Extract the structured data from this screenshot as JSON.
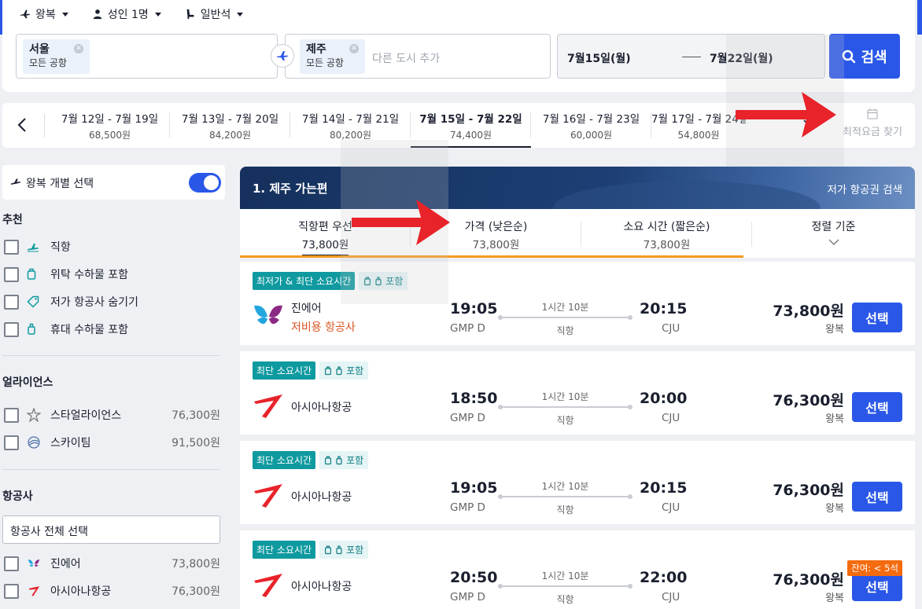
{
  "options": {
    "trip": "왕복",
    "passengers": "성인 1명",
    "cabin": "일반석"
  },
  "search": {
    "origin": {
      "city": "서울",
      "airport": "모든 공항"
    },
    "destination": {
      "city": "제주",
      "airport": "모든 공항"
    },
    "add_city_placeholder": "다른 도시 추가",
    "depart_date": "7월15일(월)",
    "return_date": "7월22일(월)",
    "button": "검색"
  },
  "date_strip": {
    "items": [
      {
        "range": "7월 12일 - 7월 19일",
        "price": "68,500원"
      },
      {
        "range": "7월 13일 - 7월 20일",
        "price": "84,200원"
      },
      {
        "range": "7월 14일 - 7월 21일",
        "price": "80,200원"
      },
      {
        "range": "7월 15일 - 7월 22일",
        "price": "74,400원"
      },
      {
        "range": "7월 16일 - 7월 23일",
        "price": "60,000원"
      },
      {
        "range": "7월 17일 - 7월 24일",
        "price": "54,800원"
      }
    ],
    "cheapest_label": "최적요금 찾기"
  },
  "sidebar": {
    "roundtrip_toggle": "왕복 개별 선택",
    "recommend_title": "추천",
    "recommend": [
      "직항",
      "위탁 수하물 포함",
      "저가 항공사 숨기기",
      "휴대 수하물 포함"
    ],
    "alliance_title": "얼라이언스",
    "alliances": [
      {
        "name": "스타얼라이언스",
        "price": "76,300원"
      },
      {
        "name": "스카이팀",
        "price": "91,500원"
      }
    ],
    "airline_title": "항공사",
    "airline_select_all": "항공사 전체 선택",
    "airlines": [
      {
        "name": "진에어",
        "price": "73,800원"
      },
      {
        "name": "아시아나항공",
        "price": "76,300원"
      }
    ]
  },
  "results": {
    "heading": "1. 제주 가는편",
    "cheap_link": "저가 항공권 검색",
    "sort": [
      {
        "title": "직항편 우선",
        "price": "73,800원"
      },
      {
        "title": "가격 (낮은순)",
        "price": "73,800원"
      },
      {
        "title": "소요 시간 (짧은순)",
        "price": "73,800원"
      },
      {
        "title": "정렬 기준",
        "price": ""
      }
    ],
    "flights": [
      {
        "badge": "최저가 & 최단 소요시간",
        "bag": "포함",
        "airline": "진에어",
        "lcc": "저비용 항공사",
        "dep": "19:05",
        "dep_code": "GMP D",
        "dur": "1시간 10분",
        "stops": "직항",
        "arr": "20:15",
        "arr_code": "CJU",
        "price": "73,800원",
        "price_note": "왕복",
        "select": "선택",
        "seats": ""
      },
      {
        "badge": "최단 소요시간",
        "bag": "포함",
        "airline": "아시아나항공",
        "lcc": "",
        "dep": "18:50",
        "dep_code": "GMP D",
        "dur": "1시간 10분",
        "stops": "직항",
        "arr": "20:00",
        "arr_code": "CJU",
        "price": "76,300원",
        "price_note": "왕복",
        "select": "선택",
        "seats": ""
      },
      {
        "badge": "최단 소요시간",
        "bag": "포함",
        "airline": "아시아나항공",
        "lcc": "",
        "dep": "19:05",
        "dep_code": "GMP D",
        "dur": "1시간 10분",
        "stops": "직항",
        "arr": "20:15",
        "arr_code": "CJU",
        "price": "76,300원",
        "price_note": "왕복",
        "select": "선택",
        "seats": ""
      },
      {
        "badge": "최단 소요시간",
        "bag": "포함",
        "airline": "아시아나항공",
        "lcc": "",
        "dep": "20:50",
        "dep_code": "GMP D",
        "dur": "1시간 10분",
        "stops": "직항",
        "arr": "22:00",
        "arr_code": "CJU",
        "price": "76,300원",
        "price_note": "왕복",
        "select": "선택",
        "seats": "잔여: < 5석"
      }
    ]
  },
  "colors": {
    "accent": "#2a57e8",
    "teal": "#0f9aa0",
    "orange": "#f59b1e",
    "arrow": "#e8232a"
  }
}
